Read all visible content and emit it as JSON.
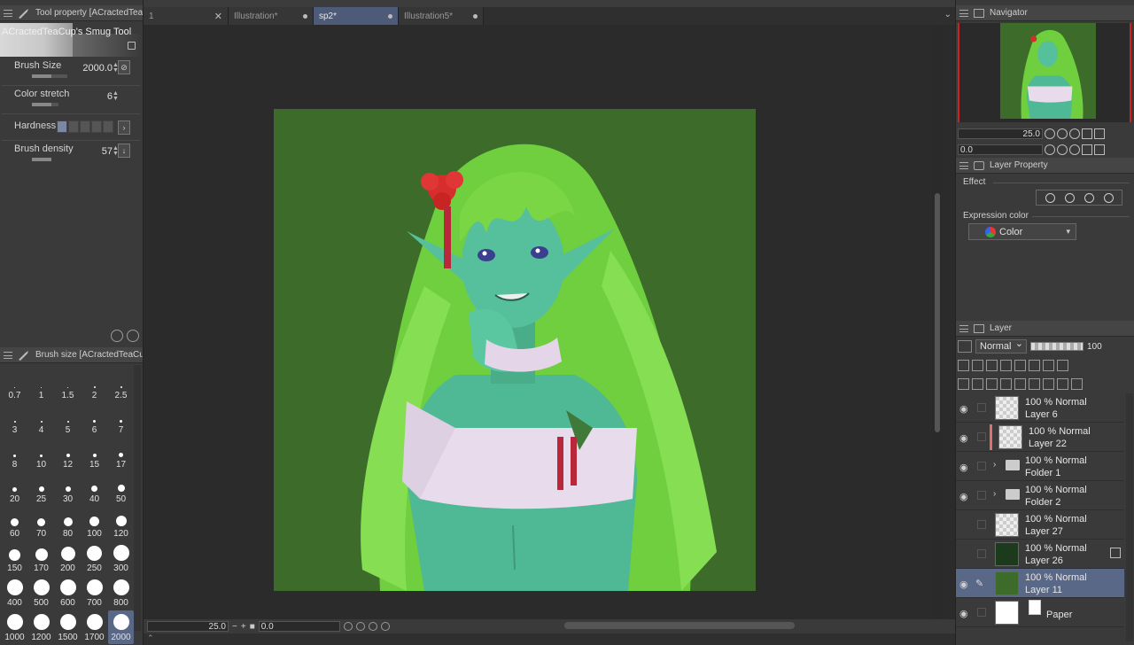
{
  "tool_property": {
    "header": "Tool property [ACractedTea...",
    "tool_name": "ACractedTeaCup's Smug Tool",
    "props": [
      {
        "label": "Brush Size",
        "value": "2000.0"
      },
      {
        "label": "Color stretch",
        "value": "6"
      },
      {
        "label": "Hardness",
        "value": ""
      },
      {
        "label": "Brush density",
        "value": "57"
      }
    ]
  },
  "brush_size_panel": {
    "header": "Brush size [ACractedTeaCup",
    "sizes": [
      "0.7",
      "1",
      "1.5",
      "2",
      "2.5",
      "3",
      "4",
      "5",
      "6",
      "7",
      "8",
      "10",
      "12",
      "15",
      "17",
      "20",
      "25",
      "30",
      "40",
      "50",
      "60",
      "70",
      "80",
      "100",
      "120",
      "150",
      "170",
      "200",
      "250",
      "300",
      "400",
      "500",
      "600",
      "700",
      "800",
      "1000",
      "1200",
      "1500",
      "1700",
      "2000"
    ],
    "selected": "2000"
  },
  "tabs": [
    {
      "label": "1",
      "state": "close"
    },
    {
      "label": "Illustration*",
      "state": "dot"
    },
    {
      "label": "sp2*",
      "state": "dot",
      "active": true
    },
    {
      "label": "Illustration5*",
      "state": "dot"
    }
  ],
  "canvas": {
    "zoom": "25.0",
    "rotation": "0.0",
    "background": "#3d6b2a"
  },
  "navigator": {
    "title": "Navigator",
    "zoom": "25.0",
    "rotation": "0.0"
  },
  "layer_property": {
    "title": "Layer Property",
    "effect_label": "Effect",
    "expression_label": "Expression color",
    "expression_value": "Color"
  },
  "layer_panel": {
    "title": "Layer",
    "blend_mode": "Normal",
    "opacity": "100",
    "layers": [
      {
        "opacity": "100 % Normal",
        "name": "Layer 6",
        "thumb": "checker"
      },
      {
        "opacity": "100 % Normal",
        "name": "Layer 22",
        "thumb": "checker",
        "mark": "red"
      },
      {
        "opacity": "100 % Normal",
        "name": "Folder 1",
        "thumb": "folder"
      },
      {
        "opacity": "100 % Normal",
        "name": "Folder 2",
        "thumb": "folder"
      },
      {
        "opacity": "100 % Normal",
        "name": "Layer 27",
        "thumb": "checker"
      },
      {
        "opacity": "100 % Normal",
        "name": "Layer 26",
        "thumb": "sil"
      },
      {
        "opacity": "100 % Normal",
        "name": "Layer 11",
        "thumb": "green",
        "selected": true
      },
      {
        "opacity": "",
        "name": "Paper",
        "thumb": "white"
      }
    ]
  }
}
